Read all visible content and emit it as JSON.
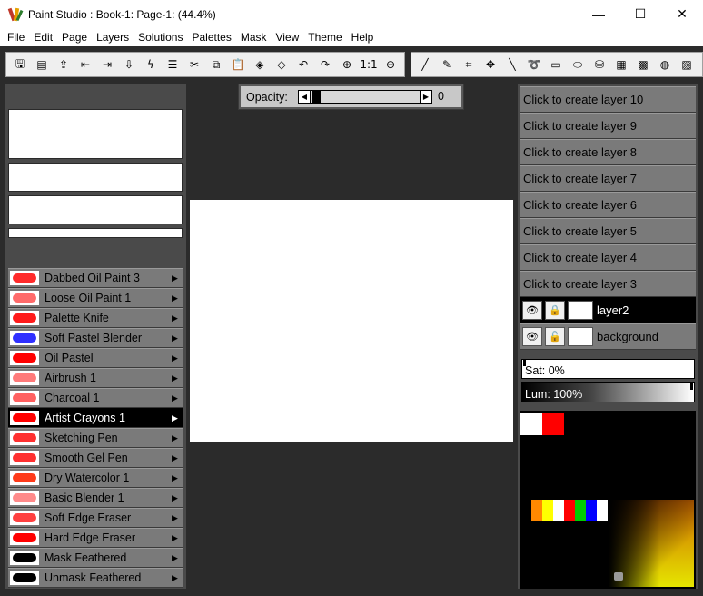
{
  "window": {
    "title": "Paint Studio : Book-1: Page-1:  (44.4%)",
    "minimize": "—",
    "maximize": "☐",
    "close": "✕"
  },
  "menu": [
    "File",
    "Edit",
    "Page",
    "Layers",
    "Solutions",
    "Palettes",
    "Mask",
    "View",
    "Theme",
    "Help"
  ],
  "toolbar1": [
    {
      "icon": "save-icon",
      "glyph": "🖫"
    },
    {
      "icon": "save-as-icon",
      "glyph": "▤"
    },
    {
      "icon": "page-up-icon",
      "glyph": "⇪"
    },
    {
      "icon": "page-prev-icon",
      "glyph": "⇤"
    },
    {
      "icon": "page-next-icon",
      "glyph": "⇥"
    },
    {
      "icon": "page-down-icon",
      "glyph": "⇩"
    },
    {
      "icon": "lightning-icon",
      "glyph": "ϟ"
    },
    {
      "icon": "properties-icon",
      "glyph": "☰"
    },
    {
      "icon": "cut-icon",
      "glyph": "✂"
    },
    {
      "icon": "copy-icon",
      "glyph": "⧉"
    },
    {
      "icon": "paste-icon",
      "glyph": "📋"
    },
    {
      "icon": "fill-icon",
      "glyph": "◈"
    },
    {
      "icon": "fill-special-icon",
      "glyph": "◇"
    },
    {
      "icon": "undo-icon",
      "glyph": "↶"
    },
    {
      "icon": "redo-icon",
      "glyph": "↷"
    },
    {
      "icon": "zoom-in-icon",
      "glyph": "⊕"
    },
    {
      "icon": "actual-size-icon",
      "glyph": "1:1"
    },
    {
      "icon": "zoom-out-icon",
      "glyph": "⊖"
    }
  ],
  "toolbar2": [
    {
      "icon": "brush-icon",
      "glyph": "╱"
    },
    {
      "icon": "eyedropper-icon",
      "glyph": "✎"
    },
    {
      "icon": "crop-icon",
      "glyph": "⌗"
    },
    {
      "icon": "move-icon",
      "glyph": "✥"
    },
    {
      "icon": "line-icon",
      "glyph": "╲"
    },
    {
      "icon": "lasso-icon",
      "glyph": "➰"
    },
    {
      "icon": "rectangle-icon",
      "glyph": "▭"
    },
    {
      "icon": "ellipse-icon",
      "glyph": "⬭"
    },
    {
      "icon": "bucket-icon",
      "glyph": "⛁"
    },
    {
      "icon": "gradient-icon",
      "glyph": "▦"
    },
    {
      "icon": "pattern-icon",
      "glyph": "▩"
    },
    {
      "icon": "texture-icon",
      "glyph": "◍"
    },
    {
      "icon": "more-tools-icon",
      "glyph": "▨"
    }
  ],
  "opacity": {
    "label": "Opacity:",
    "value": "0",
    "left_arrow": "◀",
    "right_arrow": "▶"
  },
  "brushes": [
    {
      "label": "Dabbed Oil Paint 3",
      "selected": false,
      "stroke": "#ff2a2a"
    },
    {
      "label": "Loose Oil Paint 1",
      "selected": false,
      "stroke": "#ff6a6a"
    },
    {
      "label": "Palette Knife",
      "selected": false,
      "stroke": "#ff1a1a"
    },
    {
      "label": "Soft Pastel Blender",
      "selected": false,
      "stroke": "#3030ff"
    },
    {
      "label": "Oil Pastel",
      "selected": false,
      "stroke": "#ff0000"
    },
    {
      "label": "Airbrush 1",
      "selected": false,
      "stroke": "#ff7a7a"
    },
    {
      "label": "Charcoal 1",
      "selected": false,
      "stroke": "#ff6060"
    },
    {
      "label": "Artist Crayons 1",
      "selected": true,
      "stroke": "#ff0000"
    },
    {
      "label": "Sketching Pen",
      "selected": false,
      "stroke": "#ff3030"
    },
    {
      "label": "Smooth Gel Pen",
      "selected": false,
      "stroke": "#ff3030"
    },
    {
      "label": "Dry Watercolor 1",
      "selected": false,
      "stroke": "#ff3a1a"
    },
    {
      "label": "Basic Blender 1",
      "selected": false,
      "stroke": "#ff8a8a"
    },
    {
      "label": "Soft Edge Eraser",
      "selected": false,
      "stroke": "#ff4040"
    },
    {
      "label": "Hard Edge Eraser",
      "selected": false,
      "stroke": "#ff0000"
    },
    {
      "label": "Mask Feathered",
      "selected": false,
      "stroke": "#000000"
    },
    {
      "label": "Unmask Feathered",
      "selected": false,
      "stroke": "#000000"
    }
  ],
  "brush_arrow": "▶",
  "layers": {
    "empty": [
      "Click to create layer 10",
      "Click to create layer 9",
      "Click to create layer 8",
      "Click to create layer 7",
      "Click to create layer 6",
      "Click to create layer 5",
      "Click to create layer 4",
      "Click to create layer 3"
    ],
    "existing": [
      {
        "name": "layer2",
        "active": true,
        "eye": "👁",
        "lock": "🔒"
      },
      {
        "name": "background",
        "active": false,
        "eye": "👁",
        "lock": "🔓"
      }
    ]
  },
  "saturation": {
    "label": "Sat: 0%"
  },
  "luminance": {
    "label": "Lum: 100%"
  },
  "colors": {
    "primary": "#ffffff",
    "secondary": "#ff0000",
    "swatches": [
      "#ff8800",
      "#ffff00",
      "#ffffff",
      "#ff0000",
      "#00cc00",
      "#0000ff",
      "#ffffff"
    ]
  }
}
